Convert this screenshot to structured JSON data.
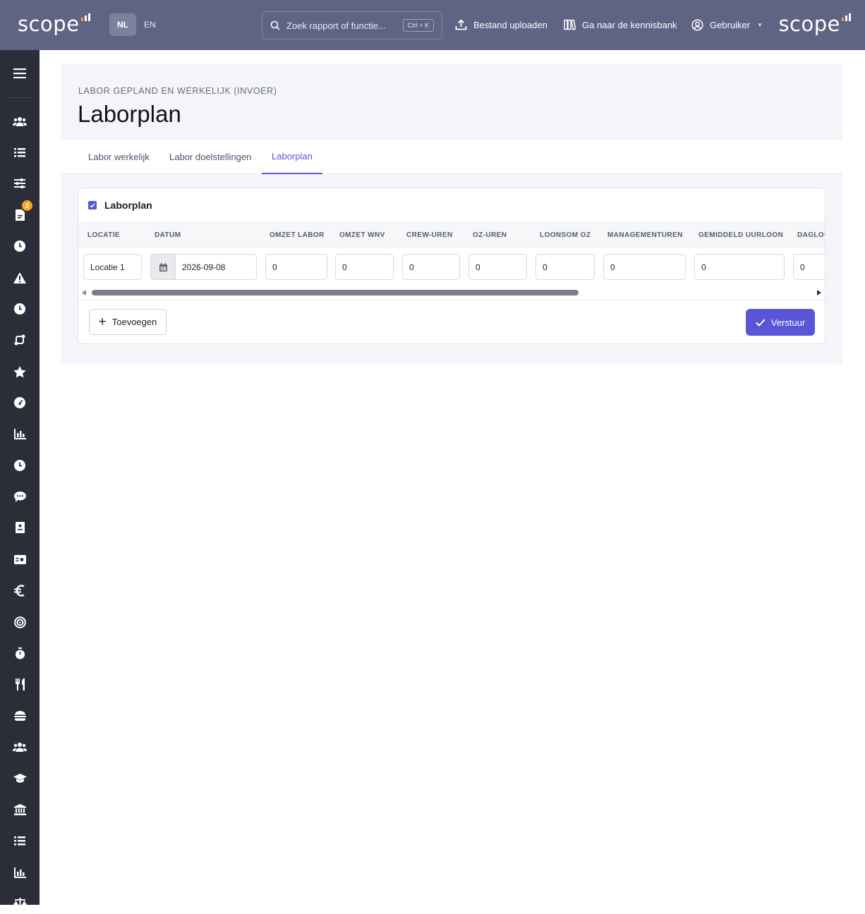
{
  "topbar": {
    "logo": "scope",
    "languages": [
      "NL",
      "EN"
    ],
    "search_placeholder": "Zoek rapport of functie...",
    "search_shortcut": "Ctrl + K",
    "upload_label": "Bestand uploaden",
    "knowledgebase_label": "Ga naar de kennisbank",
    "user_label": "Gebruiker"
  },
  "sidebar": {
    "badge_count": "2",
    "icons": [
      "menu-icon",
      "users-icon",
      "list-icon",
      "sliders-icon",
      "document-icon",
      "clock-icon",
      "warning-icon",
      "clock-icon",
      "route-icon",
      "star-icon",
      "gauge-icon",
      "bar-chart-icon",
      "clock-icon",
      "chat-icon",
      "report-icon",
      "id-card-icon",
      "euro-icon",
      "target-icon",
      "stopwatch-icon",
      "cutlery-icon",
      "burger-icon",
      "team-icon",
      "graduation-icon",
      "bank-icon",
      "checklist-icon",
      "chart-icon",
      "scale-icon"
    ]
  },
  "page": {
    "breadcrumb": "LABOR GEPLAND EN WERKELIJK (INVOER)",
    "title": "Laborplan"
  },
  "tabs": [
    "Labor werkelijk",
    "Labor doelstellingen",
    "Laborplan"
  ],
  "card": {
    "title": "Laborplan",
    "columns": [
      "LOCATIE",
      "DATUM",
      "OMZET LABOR",
      "OMZET WNV",
      "CREW-UREN",
      "OZ-UREN",
      "LOONSOM OZ",
      "MANAGEMENTUREN",
      "GEMIDDELD UURLOON",
      "DAGLOO"
    ],
    "row": {
      "locatie": "Locatie 1",
      "datum": "2026-09-08",
      "omzet_labor": "0",
      "omzet_wnv": "0",
      "crew_uren": "0",
      "oz_uren": "0",
      "loonsom_oz": "0",
      "managementuren": "0",
      "gemiddeld_uurloon": "0",
      "dagloon": "0"
    },
    "add_label": "Toevoegen",
    "submit_label": "Verstuur"
  },
  "colors": {
    "accent": "#5856d6",
    "topbar": "#5f6384",
    "sidebar": "#2b2d38",
    "badge": "#f5a524"
  }
}
